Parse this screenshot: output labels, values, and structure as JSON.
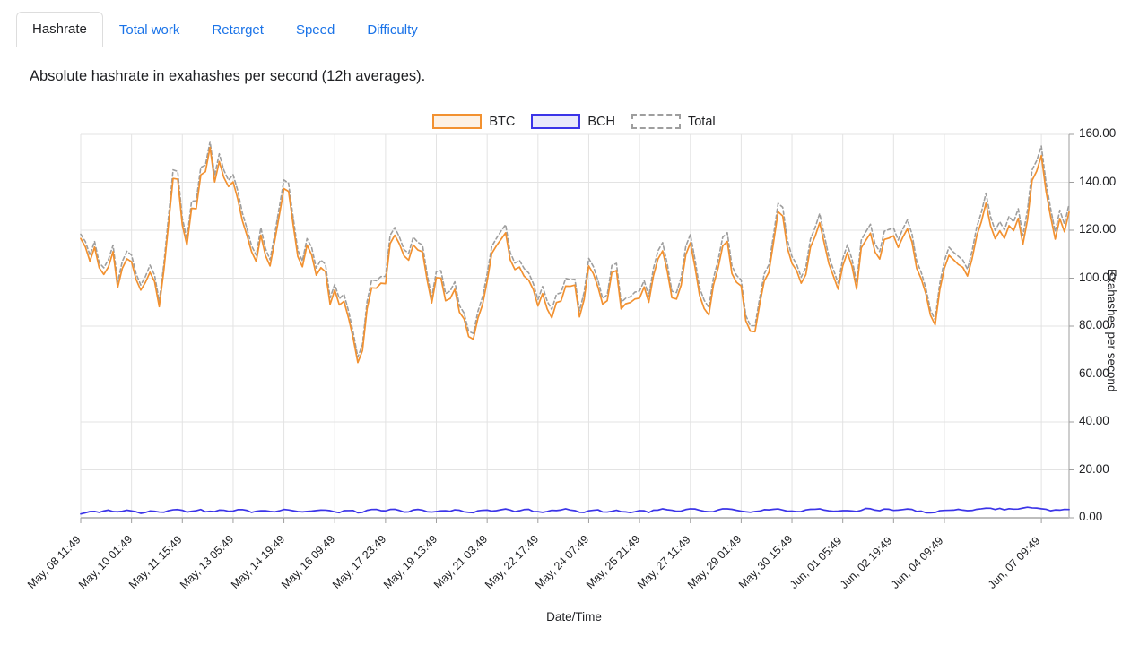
{
  "tabs": [
    {
      "label": "Hashrate",
      "active": true
    },
    {
      "label": "Total work",
      "active": false
    },
    {
      "label": "Retarget",
      "active": false
    },
    {
      "label": "Speed",
      "active": false
    },
    {
      "label": "Difficulty",
      "active": false
    }
  ],
  "description": {
    "before": "Absolute hashrate in exahashes per second (",
    "link": "12h averages",
    "after": ")."
  },
  "legend": [
    {
      "name": "BTC",
      "color": "#f29130",
      "fill": "#fdf1e4",
      "style": "solid"
    },
    {
      "name": "BCH",
      "color": "#3b34e8",
      "fill": "#e9e8fb",
      "style": "solid"
    },
    {
      "name": "Total",
      "color": "#9e9e9e",
      "fill": "#ffffff",
      "style": "dashed"
    }
  ],
  "chart_data": {
    "type": "line",
    "title": "",
    "xlabel": "Date/Time",
    "ylabel": "Exahashes per second",
    "ylim": [
      0,
      160
    ],
    "yticks": [
      "0.00",
      "20.00",
      "40.00",
      "60.00",
      "80.00",
      "100.00",
      "120.00",
      "140.00",
      "160.00"
    ],
    "ytick_values": [
      0,
      20,
      40,
      60,
      80,
      100,
      120,
      140,
      160
    ],
    "grid": true,
    "legend_position": "top-center",
    "y_axis_side": "right",
    "xticks": [
      "May, 08 11:49",
      "May, 10 01:49",
      "May, 11 15:49",
      "May, 13 05:49",
      "May, 14 19:49",
      "May, 16 09:49",
      "May, 17 23:49",
      "May, 19 13:49",
      "May, 21 03:49",
      "May, 22 17:49",
      "May, 24 07:49",
      "May, 25 21:49",
      "May, 27 11:49",
      "May, 29 01:49",
      "May, 30 15:49",
      "Jun, 01 05:49",
      "Jun, 02 19:49",
      "Jun, 04 09:49",
      "Jun, 07 09:49"
    ],
    "xtick_indices": [
      0,
      11,
      22,
      33,
      44,
      55,
      66,
      77,
      88,
      99,
      110,
      121,
      132,
      143,
      154,
      165,
      176,
      187,
      208
    ],
    "n_points": 215,
    "series": [
      {
        "name": "BTC",
        "color": "#f29130",
        "style": "solid",
        "values": [
          117,
          111,
          106,
          114,
          104,
          97,
          101,
          109,
          95,
          104,
          111,
          107,
          99,
          95,
          93,
          106,
          97,
          92,
          99,
          122,
          138,
          136,
          127,
          113,
          125,
          132,
          143,
          149,
          151,
          143,
          150,
          141,
          137,
          142,
          133,
          128,
          114,
          104,
          110,
          122,
          106,
          102,
          117,
          131,
          138,
          130,
          116,
          110,
          104,
          113,
          107,
          101,
          108,
          99,
          93,
          88,
          94,
          90,
          80,
          71,
          61,
          75,
          85,
          93,
          99,
          92,
          106,
          113,
          119,
          112,
          104,
          111,
          118,
          113,
          104,
          97,
          92,
          101,
          95,
          89,
          98,
          92,
          84,
          78,
          71,
          76,
          86,
          97,
          104,
          110,
          118,
          122,
          112,
          104,
          97,
          105,
          98,
          91,
          96,
          89,
          94,
          88,
          83,
          91,
          98,
          92,
          97,
          90,
          85,
          95,
          104,
          98,
          92,
          86,
          94,
          101,
          96,
          89,
          84,
          92,
          99,
          94,
          88,
          96,
          104,
          110,
          103,
          96,
          90,
          98,
          106,
          113,
          107,
          99,
          93,
          87,
          95,
          103,
          110,
          117,
          110,
          102,
          95,
          88,
          82,
          76,
          86,
          97,
          105,
          113,
          122,
          129,
          120,
          110,
          103,
          96,
          104,
          112,
          119,
          127,
          118,
          109,
          101,
          94,
          102,
          110,
          104,
          97,
          105,
          113,
          121,
          114,
          106,
          113,
          121,
          115,
          108,
          116,
          124,
          117,
          109,
          101,
          94,
          86,
          80,
          93,
          104,
          111,
          105,
          112,
          104,
          97,
          105,
          113,
          121,
          129,
          122,
          114,
          122,
          116,
          124,
          117,
          125,
          119,
          127,
          135,
          143,
          148,
          140,
          131,
          122,
          128,
          120,
          126
        ]
      },
      {
        "name": "BCH",
        "color": "#3b34e8",
        "style": "solid",
        "values": [
          1.8,
          2.2,
          2.6,
          2.4,
          2.1,
          2.8,
          3.1,
          2.7,
          2.3,
          2.9,
          3.2,
          2.8,
          2.4,
          2.1,
          2.5,
          3.0,
          2.7,
          2.3,
          2.6,
          3.3,
          3.6,
          3.2,
          2.8,
          2.5,
          3.0,
          3.4,
          3.1,
          2.7,
          2.4,
          2.9,
          3.3,
          3.0,
          2.6,
          3.1,
          3.5,
          3.2,
          2.8,
          2.4,
          2.7,
          3.2,
          2.9,
          2.5,
          3.0,
          3.4,
          3.7,
          3.3,
          2.9,
          2.6,
          2.3,
          2.8,
          3.2,
          2.9,
          3.3,
          3.0,
          2.6,
          2.3,
          2.7,
          3.1,
          2.8,
          2.4,
          2.2,
          2.7,
          3.1,
          3.4,
          3.0,
          2.7,
          3.2,
          3.5,
          3.1,
          2.8,
          2.5,
          3.0,
          3.4,
          3.1,
          2.7,
          2.4,
          2.2,
          2.8,
          3.2,
          2.9,
          3.3,
          3.0,
          2.6,
          2.3,
          2.1,
          2.6,
          3.0,
          3.4,
          3.1,
          2.8,
          3.3,
          3.6,
          3.2,
          2.9,
          2.5,
          3.0,
          3.4,
          3.0,
          2.7,
          2.4,
          2.8,
          3.2,
          2.9,
          3.3,
          3.6,
          3.2,
          2.9,
          2.5,
          2.3,
          2.8,
          3.3,
          3.0,
          2.6,
          2.3,
          2.8,
          3.2,
          2.9,
          2.5,
          2.2,
          2.7,
          3.1,
          2.8,
          2.4,
          2.9,
          3.3,
          3.6,
          3.2,
          2.8,
          2.5,
          3.0,
          3.4,
          3.7,
          3.3,
          2.9,
          2.6,
          2.3,
          2.8,
          3.2,
          3.5,
          3.8,
          3.4,
          3.0,
          2.7,
          2.3,
          2.1,
          2.5,
          2.9,
          3.3,
          3.0,
          3.4,
          3.7,
          3.4,
          3.0,
          2.7,
          2.4,
          2.9,
          3.3,
          3.6,
          3.9,
          3.5,
          3.1,
          2.8,
          2.4,
          2.9,
          3.3,
          3.0,
          2.6,
          3.1,
          3.5,
          3.8,
          3.4,
          3.0,
          3.4,
          3.7,
          3.3,
          3.0,
          3.4,
          3.8,
          3.4,
          3.1,
          2.7,
          2.4,
          2.2,
          2.0,
          2.6,
          3.1,
          3.4,
          3.1,
          3.5,
          3.1,
          2.8,
          3.2,
          3.6,
          3.9,
          4.2,
          3.8,
          3.4,
          3.8,
          3.5,
          3.9,
          3.6,
          4.0,
          3.7,
          4.1,
          4.4,
          4.0,
          3.7,
          3.4,
          3.1,
          3.5,
          3.2,
          3.6,
          3.3
        ]
      },
      {
        "name": "Total",
        "color": "#9e9e9e",
        "style": "dashed",
        "values": [
          118.8,
          113.2,
          108.6,
          116.4,
          106.1,
          99.8,
          104.1,
          111.7,
          97.3,
          106.9,
          114.2,
          109.8,
          101.4,
          97.1,
          95.5,
          109,
          99.7,
          94.3,
          101.6,
          125.3,
          141.6,
          139.2,
          129.8,
          115.5,
          128,
          135.4,
          146.1,
          151.7,
          153.4,
          145.9,
          153.3,
          144,
          139.6,
          145.1,
          136.5,
          131.2,
          116.8,
          106.4,
          112.7,
          125.2,
          108.9,
          104.5,
          120,
          134.4,
          141.7,
          133.3,
          118.9,
          112.6,
          106.3,
          115.8,
          110.2,
          103.9,
          111.3,
          102,
          95.6,
          90.3,
          96.7,
          93.1,
          82.8,
          73.4,
          63.2,
          77.7,
          88.1,
          96.4,
          102,
          94.7,
          109.2,
          116.5,
          122.1,
          114.8,
          106.5,
          114,
          121.4,
          116.1,
          106.7,
          99.4,
          94.2,
          103.8,
          98.2,
          91.9,
          101.3,
          95,
          86.6,
          80.3,
          73.1,
          78.6,
          89,
          100.4,
          107.1,
          112.8,
          121.3,
          125.6,
          115.2,
          106.9,
          99.5,
          108,
          101.4,
          93.7,
          98.4,
          91.8,
          97.2,
          91.3,
          86.6,
          94.3,
          101.6,
          94.9,
          99.5,
          92.3,
          87.8,
          98.3,
          107,
          101,
          94.5,
          88.2,
          96.8,
          104.1,
          98.9,
          91.4,
          86.2,
          94.7,
          102.1,
          96.8,
          90.4,
          98.9,
          107.3,
          113.6,
          106.2,
          98.8,
          92.5,
          101,
          109.4,
          116.7,
          110.3,
          101.9,
          96.6,
          90.3,
          97.8,
          106.2,
          113.5,
          120.8,
          113.4,
          105,
          97.7,
          90.3,
          84.1,
          78.5,
          88.5,
          99.9,
          108.3,
          116,
          125.4,
          132.7,
          123.4,
          113,
          105.7,
          98.4,
          106.9,
          115.3,
          122.6,
          130.9,
          121.5,
          112.1,
          103.8,
          96.4,
          104.9,
          113.3,
          107,
          99.6,
          108.1,
          116.5,
          124.8,
          117.4,
          109,
          116.4,
          124.7,
          118.3,
          111,
          119.4,
          127.8,
          120.4,
          112.1,
          103.7,
          96.4,
          88.2,
          82,
          95.6,
          107.1,
          114.4,
          108.1,
          115.5,
          107.1,
          99.8,
          108.2,
          116.6,
          124.9,
          133.2,
          125.8,
          117.4,
          125.8,
          119.5,
          127.9,
          120.6,
          129,
          122.7,
          131.1,
          139.4,
          147.4,
          152,
          143.7,
          134.4,
          125.1,
          131.5,
          123.2,
          129.3
        ]
      }
    ]
  }
}
